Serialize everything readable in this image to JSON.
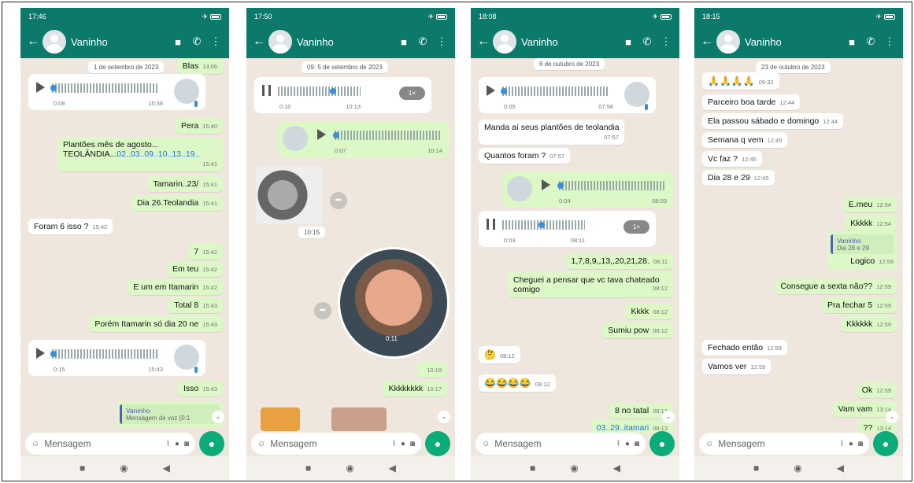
{
  "common": {
    "contact": "Vaninho",
    "placeholder": "Mensagem",
    "back": "←",
    "video": "■",
    "call": "✆",
    "menu": "⋮"
  },
  "phones": [
    {
      "time": "17:46",
      "date": "1 de setembro de 2023",
      "top_text": "Blas",
      "top_time": "13:06",
      "voice1": {
        "dur": "0:08",
        "time": "15:38"
      },
      "m1": {
        "text": "Pera",
        "time": "15:40"
      },
      "m2": {
        "line1": "Plantões mês de agosto...",
        "line2a": "TEOLÂNDIA...",
        "line2b": "02..03..09..10..13..19..",
        "time": "15:41"
      },
      "m3": {
        "text": "Tamarin..23/",
        "time": "15:41"
      },
      "m4": {
        "text": "Dia 26.Teolandia",
        "time": "15:41"
      },
      "m5": {
        "text": "Foram 6 isso ?",
        "time": "15:42"
      },
      "m6": {
        "text": "7",
        "time": "15:42"
      },
      "m7": {
        "text": "Em teu",
        "time": "15:42"
      },
      "m8": {
        "text": "E um em Itamarin",
        "time": "15:42"
      },
      "m9": {
        "text": "Total 8",
        "time": "15:43"
      },
      "m10": {
        "text": "Porém Itamarin só dia 20 ne",
        "time": "15:43"
      },
      "voice2": {
        "dur": "0:15",
        "time": "15:43"
      },
      "m11": {
        "text": "Isso",
        "time": "15:43"
      },
      "reply": {
        "name": "Vaninho",
        "text": "Mensagem de voz (0:1"
      }
    },
    {
      "time": "17:50",
      "date": "5 de setembro de 2023",
      "top_time": "09:",
      "voice1": {
        "dur": "0:10",
        "time": "10:13",
        "speed": "1×"
      },
      "voice2": {
        "dur": "0:07",
        "time": "10:14"
      },
      "sticker_time": "10:15",
      "video_dur": "0:11",
      "video_time": "10:16",
      "m1": {
        "text": "Kkkkkkkk",
        "time": "10:17"
      }
    },
    {
      "time": "18:08",
      "date": "6 de outubro de 2023",
      "voice1": {
        "dur": "0:05",
        "time": "07:56"
      },
      "m1": {
        "text": "Manda aí seus plantões de teolandia",
        "time": "07:57"
      },
      "m2": {
        "text": "Quantos foram ?",
        "time": "07:57"
      },
      "voice2": {
        "dur": "0:04",
        "time": "08:09"
      },
      "voice3": {
        "dur": "0:03",
        "time": "08:11",
        "speed": "1×"
      },
      "m3": {
        "text": "1,7,8,9,,13,,20,21,28.",
        "time": "08:11"
      },
      "m4": {
        "line1": "Cheguei a pensar que vc tava  chateado",
        "line2": "comigo",
        "time": "08:12"
      },
      "m5": {
        "text": "Kkkk",
        "time": "08:12"
      },
      "m6": {
        "text": "Sumiu pow",
        "time": "08:12"
      },
      "m7": {
        "text": "🤔",
        "time": "08:12"
      },
      "m8": {
        "text": "😂😂😂😂",
        "time": "08:12"
      },
      "m9": {
        "text": "8 no tatal",
        "time": "08:13"
      },
      "m10": {
        "text": "03..29..itamari",
        "time": "08:13"
      }
    },
    {
      "time": "18:15",
      "date": "23 de outubro de 2023",
      "m0": {
        "text": "🙏🙏🙏🙏",
        "time": "09:32"
      },
      "m1": {
        "text": "Parceiro boa tarde",
        "time": "12:44"
      },
      "m2": {
        "text": "Ela passou sábado e domingo",
        "time": "12:44"
      },
      "m3": {
        "text": "Semana q vem",
        "time": "12:45"
      },
      "m4": {
        "text": "Vc faz ?",
        "time": "12:45"
      },
      "m5": {
        "text": "Dia 28 e 29",
        "time": "12:45"
      },
      "m6": {
        "text": "E.meu",
        "time": "12:54"
      },
      "m7": {
        "text": "Kkkkk",
        "time": "12:54"
      },
      "reply": {
        "name": "Vaninho",
        "text": "Dia 28 e 29",
        "body": "Logico",
        "time": "12:59"
      },
      "m8": {
        "text": "Consegue a sexta não??",
        "time": "12:59"
      },
      "m9": {
        "text": "Pra fechar 5",
        "time": "12:59"
      },
      "m10": {
        "text": "Kkkkkk",
        "time": "12:59"
      },
      "m11": {
        "text": "Fechado então",
        "time": "12:59"
      },
      "m12": {
        "text": "Vamos ver",
        "time": "12:59"
      },
      "m13": {
        "text": "Ok",
        "time": "12:59"
      },
      "m14": {
        "text": "Vam vam",
        "time": "13:14"
      },
      "m15": {
        "text": "??",
        "time": "13:14"
      }
    }
  ]
}
